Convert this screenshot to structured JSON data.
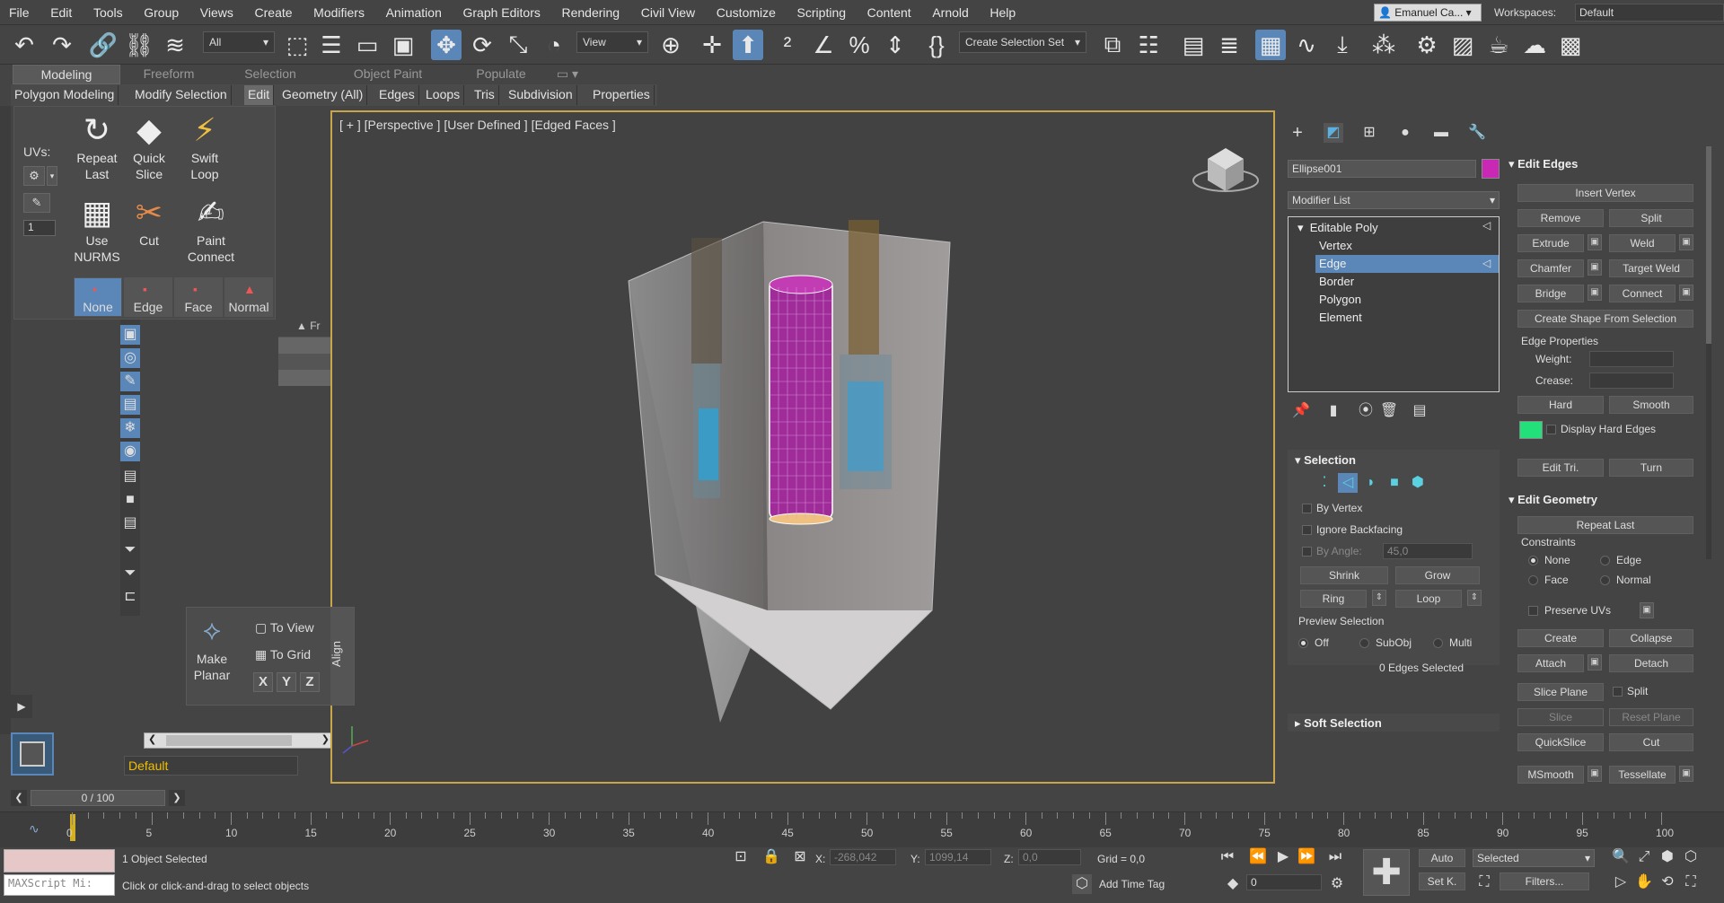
{
  "menu": [
    "File",
    "Edit",
    "Tools",
    "Group",
    "Views",
    "Create",
    "Modifiers",
    "Animation",
    "Graph Editors",
    "Rendering",
    "Civil View",
    "Customize",
    "Scripting",
    "Content",
    "Arnold",
    "Help"
  ],
  "user": "Emanuel Ca...",
  "workspaces_label": "Workspaces:",
  "workspace": "Default",
  "toolbar": {
    "filter": "All",
    "view": "View",
    "selection_set": "Create Selection Set"
  },
  "ribbon": {
    "tabs": [
      "Modeling",
      "Freeform",
      "Selection",
      "Object Paint",
      "Populate"
    ],
    "subtabs": [
      "Polygon Modeling",
      "Modify Selection",
      "Edit",
      "Geometry (All)",
      "Edges",
      "Loops",
      "Tris",
      "Subdivision",
      "Properties"
    ],
    "uvs_label": "UVs:",
    "uv_value": "1",
    "buttons": [
      {
        "line1": "Repeat",
        "line2": "Last"
      },
      {
        "line1": "Quick",
        "line2": "Slice"
      },
      {
        "line1": "Swift",
        "line2": "Loop"
      },
      {
        "line1": "Use",
        "line2": "NURMS"
      },
      {
        "line1": "Cut",
        "line2": ""
      },
      {
        "line1": "Paint",
        "line2": "Connect"
      }
    ],
    "constraints": [
      "None",
      "Edge",
      "Face",
      "Normal"
    ]
  },
  "align": {
    "make_planar_1": "Make",
    "make_planar_2": "Planar",
    "to_view": "To View",
    "to_grid": "To Grid",
    "x": "X",
    "y": "Y",
    "z": "Z",
    "title": "Align"
  },
  "scene": {
    "col_label": "Fr",
    "layer": "Default"
  },
  "viewport": {
    "label": "[ + ] [Perspective ] [User Defined ] [Edged Faces ]"
  },
  "command_panel": {
    "object_name": "Ellipse001",
    "object_color": "#c828b4",
    "modifier_list": "Modifier List",
    "stack": [
      "Editable Poly",
      "Vertex",
      "Edge",
      "Border",
      "Polygon",
      "Element"
    ],
    "selection_title": "Selection",
    "by_vertex": "By Vertex",
    "ignore_backfacing": "Ignore Backfacing",
    "by_angle": "By Angle:",
    "by_angle_value": "45,0",
    "shrink": "Shrink",
    "grow": "Grow",
    "ring": "Ring",
    "loop": "Loop",
    "preview_selection": "Preview Selection",
    "preview_options": [
      "Off",
      "SubObj",
      "Multi"
    ],
    "edges_selected": "0 Edges Selected",
    "soft_selection": "Soft Selection"
  },
  "modify_panel": {
    "edit_edges": "Edit Edges",
    "insert_vertex": "Insert Vertex",
    "remove": "Remove",
    "split": "Split",
    "extrude": "Extrude",
    "weld": "Weld",
    "chamfer": "Chamfer",
    "target_weld": "Target Weld",
    "bridge": "Bridge",
    "connect": "Connect",
    "create_shape": "Create Shape From Selection",
    "edge_properties": "Edge Properties",
    "weight": "Weight:",
    "crease": "Crease:",
    "hard": "Hard",
    "smooth": "Smooth",
    "display_hard_edges": "Display Hard Edges",
    "hard_edge_color": "#22e07a",
    "edit_tri": "Edit Tri.",
    "turn": "Turn",
    "edit_geometry": "Edit Geometry",
    "repeat_last": "Repeat Last",
    "constraints": "Constraints",
    "c_none": "None",
    "c_edge": "Edge",
    "c_face": "Face",
    "c_normal": "Normal",
    "preserve_uvs": "Preserve UVs",
    "create": "Create",
    "collapse": "Collapse",
    "attach": "Attach",
    "detach": "Detach",
    "slice_plane": "Slice Plane",
    "split2": "Split",
    "slice": "Slice",
    "reset_plane": "Reset Plane",
    "quickslice": "QuickSlice",
    "cut": "Cut",
    "msmooth": "MSmooth",
    "tessellate": "Tessellate"
  },
  "timeline": {
    "frame": "0 / 100",
    "ticks": [
      "0",
      "5",
      "10",
      "15",
      "20",
      "25",
      "30",
      "35",
      "40",
      "45",
      "50",
      "55",
      "60",
      "65",
      "70",
      "75",
      "80",
      "85",
      "90",
      "95",
      "100"
    ]
  },
  "status": {
    "maxscript": "MAXScript Mi:",
    "objects_selected": "1 Object Selected",
    "hint": "Click or click-and-drag to select objects",
    "x_label": "X:",
    "x_value": "-268,042",
    "y_label": "Y:",
    "y_value": "1099,14",
    "z_label": "Z:",
    "z_value": "0,0",
    "grid": "Grid = 0,0",
    "add_time_tag": "Add Time Tag",
    "auto": "Auto",
    "set_k": "Set K.",
    "selected": "Selected",
    "frame_value": "0",
    "filters": "Filters..."
  }
}
